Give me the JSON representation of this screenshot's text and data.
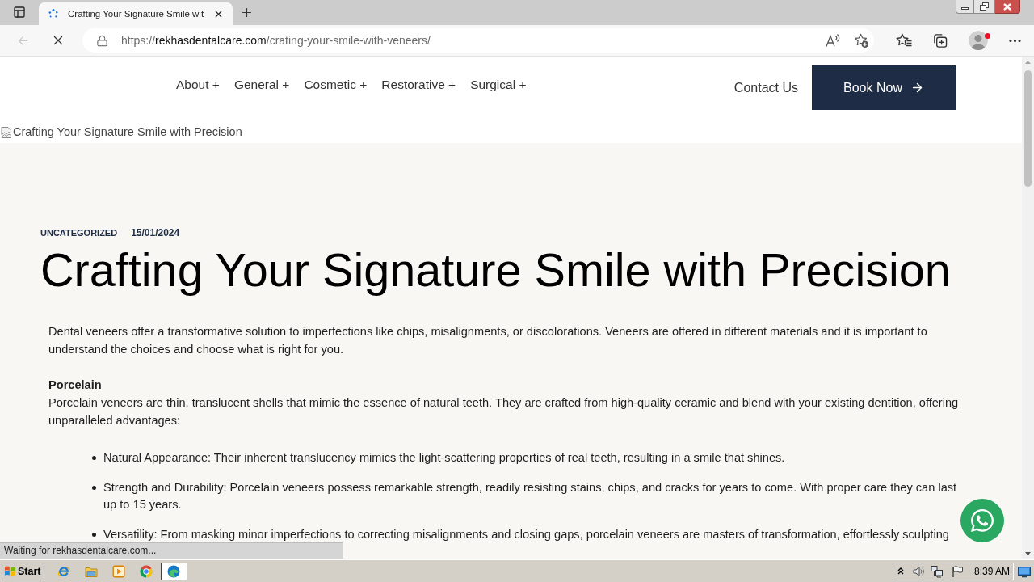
{
  "browser": {
    "tabs": [
      {
        "title": "Crafting Your Signature Smile wit",
        "selected": true,
        "loading": true
      }
    ],
    "back": {
      "disabled": true
    },
    "loading": true,
    "address": {
      "scheme": "https://",
      "host": "rekhasdentalcare.com",
      "path": "/crating-your-smile-with-veneers/"
    },
    "profile": {
      "notification": true
    },
    "status": "Waiting for rekhasdentalcare.com..."
  },
  "page": {
    "nav": {
      "items": [
        "About +",
        "General +",
        "Cosmetic +",
        "Restorative +",
        "Surgical +"
      ],
      "contact": "Contact Us",
      "cta": "Book Now"
    },
    "hero_image": {
      "alt": "Crafting Your Signature Smile with Precision"
    },
    "post": {
      "category": "UNCATEGORIZED",
      "date": "15/01/2024",
      "title": "Crafting Your Signature Smile with Precision",
      "intro": "Dental veneers offer a transformative solution to imperfections like chips, misalignments, or discolorations. Veneers are offered in different materials and it is important to understand the choices and choose what is right for you.",
      "sections": [
        {
          "heading": "Porcelain",
          "text": "Porcelain veneers are thin, translucent shells that mimic the essence of natural teeth. They are crafted from high-quality ceramic and blend with your existing dentition, offering unparalleled advantages:",
          "bullets": [
            "Natural Appearance: Their inherent translucency mimics the light-scattering properties of real teeth, resulting in a smile that shines.",
            "Strength and Durability: Porcelain veneers possess remarkable strength, readily resisting stains, chips, and cracks for years to come. With proper care they can last up to 15 years.",
            "Versatility: From masking minor imperfections to correcting misalignments and closing gaps, porcelain veneers are masters of transformation, effortlessly sculpting"
          ]
        }
      ]
    }
  },
  "taskbar": {
    "start": "Start",
    "apps": [
      {
        "kind": "ie",
        "selected": false
      },
      {
        "kind": "explorer",
        "selected": false
      },
      {
        "kind": "media",
        "selected": false
      },
      {
        "kind": "chrome",
        "selected": false
      },
      {
        "kind": "edge",
        "selected": true
      }
    ],
    "tray": {
      "clock": "8:39 AM"
    }
  }
}
